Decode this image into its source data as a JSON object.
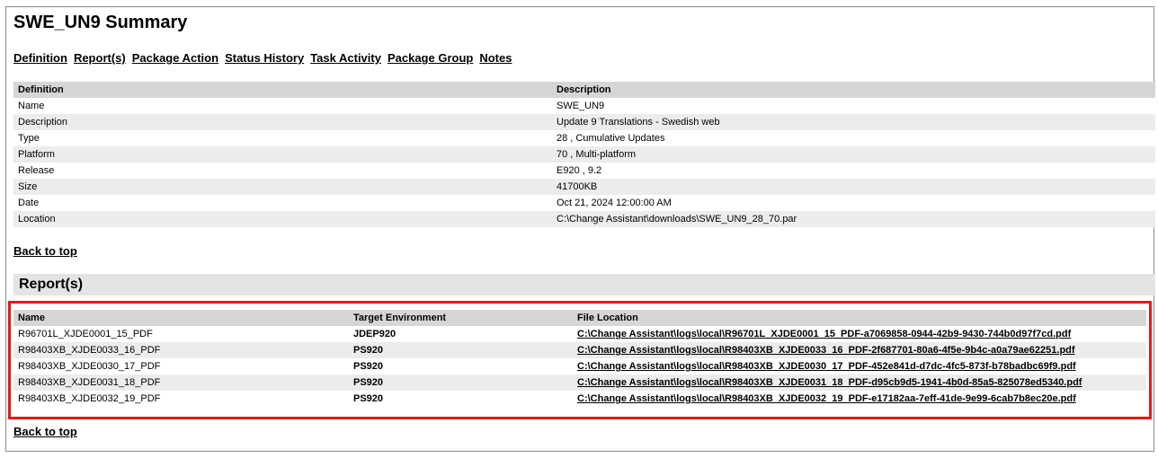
{
  "title": "SWE_UN9 Summary",
  "nav": [
    "Definition",
    "Report(s)",
    "Package Action",
    "Status History",
    "Task Activity",
    "Package Group",
    "Notes"
  ],
  "definition": {
    "headers": [
      "Definition",
      "Description"
    ],
    "rows": [
      {
        "label": "Name",
        "value": "SWE_UN9"
      },
      {
        "label": "Description",
        "value": "Update 9 Translations - Swedish web"
      },
      {
        "label": "Type",
        "value": "28 , Cumulative Updates"
      },
      {
        "label": "Platform",
        "value": "70 , Multi-platform"
      },
      {
        "label": "Release",
        "value": "E920 , 9.2"
      },
      {
        "label": "Size",
        "value": "41700KB"
      },
      {
        "label": "Date",
        "value": "Oct 21, 2024 12:00:00 AM"
      },
      {
        "label": "Location",
        "value": "C:\\Change Assistant\\downloads\\SWE_UN9_28_70.par"
      }
    ]
  },
  "back_to_top": "Back to top",
  "reports": {
    "section_title": "Report(s)",
    "headers": [
      "Name",
      "Target Environment",
      "File Location"
    ],
    "rows": [
      {
        "name": "R96701L_XJDE0001_15_PDF",
        "env": "JDEP920",
        "file": "C:\\Change Assistant\\logs\\local\\R96701L_XJDE0001_15_PDF-a7069858-0944-42b9-9430-744b0d97f7cd.pdf"
      },
      {
        "name": "R98403XB_XJDE0033_16_PDF",
        "env": "PS920",
        "file": "C:\\Change Assistant\\logs\\local\\R98403XB_XJDE0033_16_PDF-2f687701-80a6-4f5e-9b4c-a0a79ae62251.pdf"
      },
      {
        "name": "R98403XB_XJDE0030_17_PDF",
        "env": "PS920",
        "file": "C:\\Change Assistant\\logs\\local\\R98403XB_XJDE0030_17_PDF-452e841d-d7dc-4fc5-873f-b78badbc69f9.pdf"
      },
      {
        "name": "R98403XB_XJDE0031_18_PDF",
        "env": "PS920",
        "file": "C:\\Change Assistant\\logs\\local\\R98403XB_XJDE0031_18_PDF-d95cb9d5-1941-4b0d-85a5-825078ed5340.pdf"
      },
      {
        "name": "R98403XB_XJDE0032_19_PDF",
        "env": "PS920",
        "file": "C:\\Change Assistant\\logs\\local\\R98403XB_XJDE0032_19_PDF-e17182aa-7eff-41de-9e99-6cab7b8ec20e.pdf"
      }
    ]
  },
  "colors": {
    "highlight": "#e01b1b",
    "header_bg": "#d6d6d6",
    "section_bg": "#e4e4e4"
  }
}
